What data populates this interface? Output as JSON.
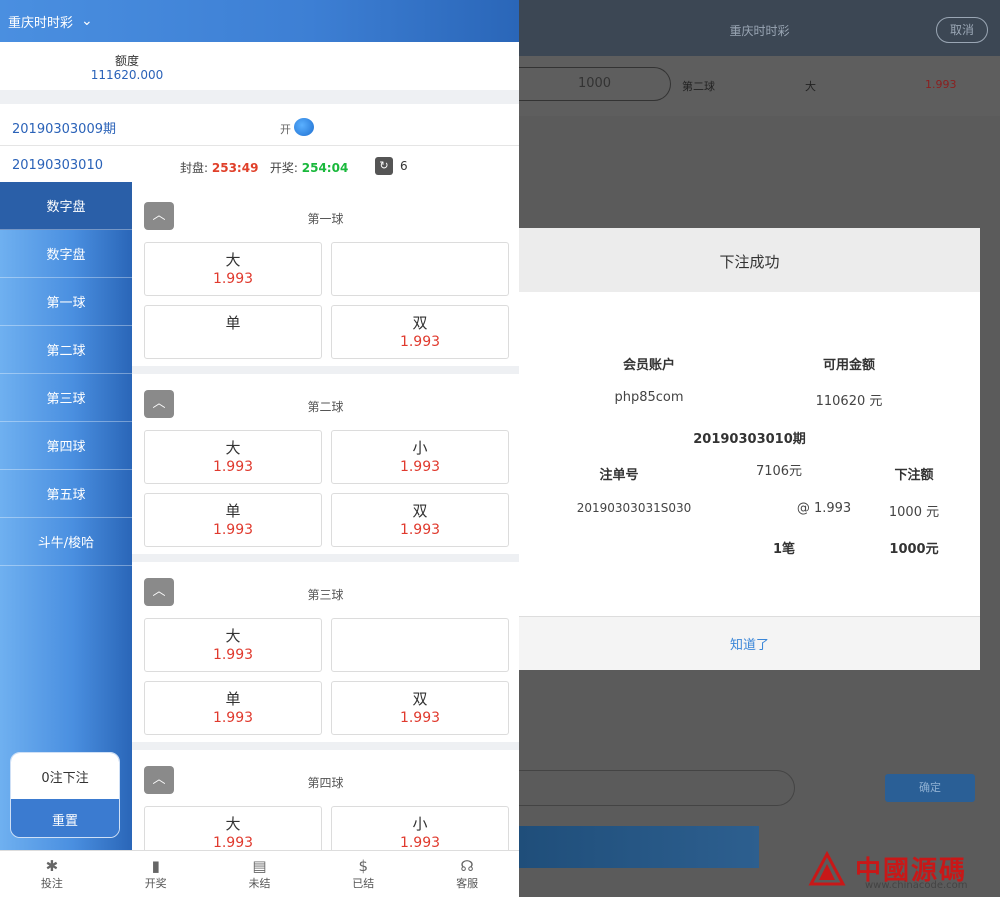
{
  "left": {
    "header": {
      "title": "重庆时时彩"
    },
    "balance": {
      "label": "额度",
      "value": "111620.000"
    },
    "periods": [
      "20190303009期",
      "20190303010"
    ],
    "open_label": "开",
    "timer": {
      "close_label": "封盘:",
      "close_time": "253:49",
      "open_label": "开奖:",
      "open_time": "254:04",
      "refresh_count": "6"
    },
    "sidebar": {
      "items": [
        {
          "label": "数字盘"
        },
        {
          "label": "数字盘"
        },
        {
          "label": "第一球"
        },
        {
          "label": "第二球"
        },
        {
          "label": "第三球"
        },
        {
          "label": "第四球"
        },
        {
          "label": "第五球"
        },
        {
          "label": "斗牛/梭哈"
        }
      ],
      "bet_count": "0注下注",
      "reset": "重置"
    },
    "sections": [
      {
        "title": "第一球",
        "cells": [
          {
            "name": "大",
            "odds": "1.993"
          },
          {
            "name": "",
            "odds": ""
          },
          {
            "name": "单",
            "odds": ""
          },
          {
            "name": "双",
            "odds": "1.993"
          }
        ]
      },
      {
        "title": "第二球",
        "cells": [
          {
            "name": "大",
            "odds": "1.993"
          },
          {
            "name": "小",
            "odds": "1.993"
          },
          {
            "name": "单",
            "odds": "1.993"
          },
          {
            "name": "双",
            "odds": "1.993"
          }
        ]
      },
      {
        "title": "第三球",
        "cells": [
          {
            "name": "大",
            "odds": "1.993"
          },
          {
            "name": "",
            "odds": ""
          },
          {
            "name": "单",
            "odds": "1.993"
          },
          {
            "name": "双",
            "odds": "1.993"
          }
        ]
      },
      {
        "title": "第四球",
        "cells": [
          {
            "name": "大",
            "odds": "1.993"
          },
          {
            "name": "小",
            "odds": "1.993"
          }
        ]
      }
    ],
    "bottom_nav": [
      {
        "label": "投注",
        "icon": "✱"
      },
      {
        "label": "开奖",
        "icon": "▮"
      },
      {
        "label": "未结",
        "icon": "▤"
      },
      {
        "label": "已结",
        "icon": "$"
      },
      {
        "label": "客服",
        "icon": "☊"
      }
    ]
  },
  "right": {
    "header": {
      "title": "重庆时时彩",
      "cancel": "取消"
    },
    "bet_row": {
      "amount": "1000",
      "ball": "第二球",
      "choice": "大",
      "odds": "1.993"
    },
    "modal": {
      "title": "下注成功",
      "account_label": "会员账户",
      "account_value": "php85com",
      "available_label": "可用金额",
      "available_value": "110620 元",
      "period": "20190303010期",
      "order_label": "注单号",
      "content_label": "7106元",
      "amount_label": "下注额",
      "order_value": "20190303031S030",
      "content_value": "@ 1.993",
      "amount_value": "1000 元",
      "total_count": "1笔",
      "total_amount": "1000元",
      "acknowledge": "知道了"
    },
    "confirm": "确定",
    "watermark": {
      "text": "中國源碼",
      "url": "www.chinacode.com"
    }
  }
}
